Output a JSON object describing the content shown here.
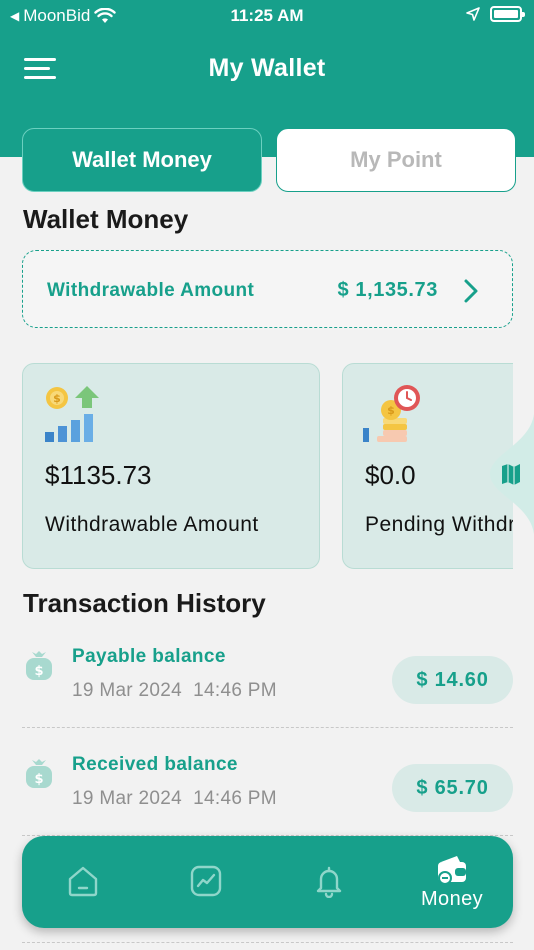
{
  "status_bar": {
    "carrier": "MoonBid",
    "time": "11:25 AM"
  },
  "header": {
    "title": "My Wallet"
  },
  "tabs": [
    {
      "label": "Wallet Money",
      "active": true
    },
    {
      "label": "My Point",
      "active": false
    }
  ],
  "wallet": {
    "section_title": "Wallet Money",
    "withdrawable_label": "Withdrawable Amount",
    "withdrawable_amount": "$ 1,135.73"
  },
  "cards": [
    {
      "value": "$1135.73",
      "caption": "Withdrawable Amount",
      "icon": "growth-coins-icon"
    },
    {
      "value": "$0.0",
      "caption": "Pending Withdrawal",
      "icon": "pending-coins-icon"
    }
  ],
  "transactions": {
    "title": "Transaction History",
    "items": [
      {
        "name": "Payable balance",
        "date": "19 Mar 2024  14:46 PM",
        "amount": "$ 14.60",
        "icon": "money-bag-icon"
      },
      {
        "name": "Received balance",
        "date": "19 Mar 2024  14:46 PM",
        "amount": "$ 65.70",
        "icon": "money-bag-icon"
      }
    ]
  },
  "bottom_nav": {
    "items": [
      {
        "icon": "home-icon",
        "label": ""
      },
      {
        "icon": "chart-icon",
        "label": ""
      },
      {
        "icon": "bell-icon",
        "label": ""
      },
      {
        "icon": "wallet-icon",
        "label": "Money",
        "active": true
      }
    ]
  },
  "colors": {
    "primary": "#17a08b",
    "card_bg": "#d9eae7",
    "background": "#f2f2f2",
    "muted_text": "#8f8f8f"
  }
}
